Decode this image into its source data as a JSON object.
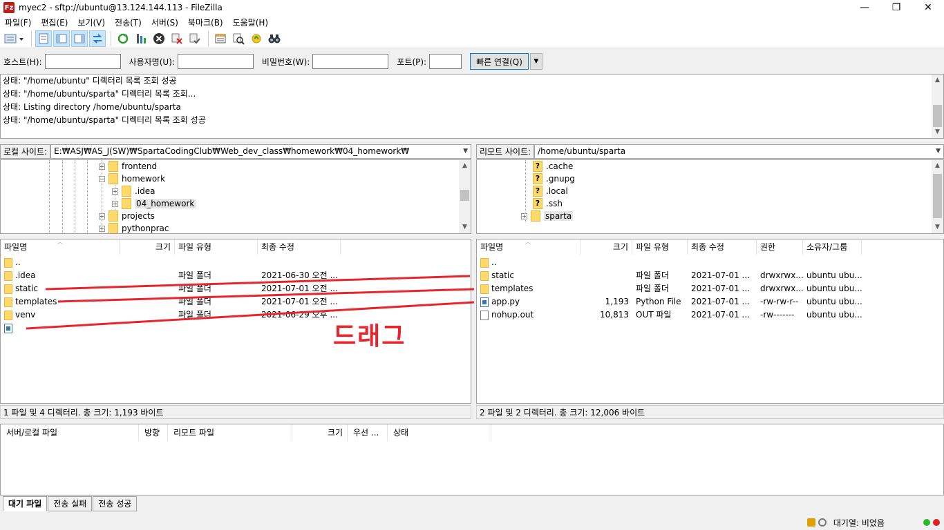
{
  "window": {
    "title": "myec2 - sftp://ubuntu@13.124.144.113 - FileZilla",
    "app_icon": "Fz",
    "minimize": "—",
    "maximize": "❐",
    "close": "✕"
  },
  "menu": [
    "파일(F)",
    "편집(E)",
    "보기(V)",
    "전송(T)",
    "서버(S)",
    "북마크(B)",
    "도움말(H)"
  ],
  "quickconnect": {
    "host_label": "호스트(H):",
    "user_label": "사용자명(U):",
    "pass_label": "비밀번호(W):",
    "port_label": "포트(P):",
    "connect_button": "빠른 연결(Q)",
    "dropdown": "▼"
  },
  "log": [
    "상태:  \"/home/ubuntu\" 디렉터리 목록 조회 성공",
    "상태:  \"/home/ubuntu/sparta\" 디렉터리 목록 조회...",
    "상태:  Listing directory /home/ubuntu/sparta",
    "상태:  \"/home/ubuntu/sparta\" 디렉터리 목록 조회 성공"
  ],
  "local": {
    "site_label": "로컬 사이트:",
    "path": "E:₩ASJ₩AS_J(SW)₩SpartaCodingClub₩Web_dev_class₩homework₩04_homework₩",
    "tree": [
      {
        "label": "frontend",
        "expander": "+"
      },
      {
        "label": "homework",
        "expander": "−"
      },
      {
        "label": ".idea",
        "expander": "+"
      },
      {
        "label": "04_homework",
        "expander": "+"
      },
      {
        "label": "projects",
        "expander": "+"
      },
      {
        "label": "pythonprac",
        "expander": "+"
      }
    ],
    "columns": {
      "name": "파일명",
      "size": "크기",
      "type": "파일 유형",
      "modified": "최종 수정"
    },
    "files": [
      {
        "name": "..",
        "size": "",
        "type": "",
        "modified": "",
        "icon": "folder"
      },
      {
        "name": ".idea",
        "size": "",
        "type": "파일 폴더",
        "modified": "2021-06-30 오전 ...",
        "icon": "folder"
      },
      {
        "name": "static",
        "size": "",
        "type": "파일 폴더",
        "modified": "2021-07-01 오전 ...",
        "icon": "folder"
      },
      {
        "name": "templates",
        "size": "",
        "type": "파일 폴더",
        "modified": "2021-07-01 오전 ...",
        "icon": "folder"
      },
      {
        "name": "venv",
        "size": "",
        "type": "파일 폴더",
        "modified": "2021-06-29 오후 ...",
        "icon": "folder"
      },
      {
        "name": "",
        "size": "",
        "type": "",
        "modified": "",
        "icon": "python-file"
      }
    ],
    "status": "1 파일 및 4 디렉터리. 총 크기: 1,193 바이트"
  },
  "remote": {
    "site_label": "리모트 사이트:",
    "path": "/home/ubuntu/sparta",
    "tree": [
      {
        "label": ".cache",
        "icon": "question-folder"
      },
      {
        "label": ".gnupg",
        "icon": "question-folder"
      },
      {
        "label": ".local",
        "icon": "question-folder"
      },
      {
        "label": ".ssh",
        "icon": "question-folder"
      },
      {
        "label": "sparta",
        "icon": "folder",
        "expander": "+"
      }
    ],
    "columns": {
      "name": "파일명",
      "size": "크기",
      "type": "파일 유형",
      "modified": "최종 수정",
      "perms": "권한",
      "owner": "소유자/그룹"
    },
    "files": [
      {
        "name": "..",
        "size": "",
        "type": "",
        "modified": "",
        "perms": "",
        "owner": "",
        "icon": "folder"
      },
      {
        "name": "static",
        "size": "",
        "type": "파일 폴더",
        "modified": "2021-07-01 ...",
        "perms": "drwxrwx...",
        "owner": "ubuntu ubu...",
        "icon": "folder"
      },
      {
        "name": "templates",
        "size": "",
        "type": "파일 폴더",
        "modified": "2021-07-01 ...",
        "perms": "drwxrwx...",
        "owner": "ubuntu ubu...",
        "icon": "folder"
      },
      {
        "name": "app.py",
        "size": "1,193",
        "type": "Python File",
        "modified": "2021-07-01 ...",
        "perms": "-rw-rw-r--",
        "owner": "ubuntu ubu...",
        "icon": "python-file"
      },
      {
        "name": "nohup.out",
        "size": "10,813",
        "type": "OUT 파일",
        "modified": "2021-07-01 ...",
        "perms": "-rw-------",
        "owner": "ubuntu ubu...",
        "icon": "file"
      }
    ],
    "status": "2 파일 및 2 디렉터리. 총 크기: 12,006 바이트"
  },
  "queue": {
    "columns": [
      "서버/로컬 파일",
      "방향",
      "리모트 파일",
      "크기",
      "우선 ...",
      "상태"
    ],
    "tabs": [
      "대기 파일",
      "전송 실패",
      "전송 성공"
    ]
  },
  "bottom": {
    "queue_status": "대기열: 비었음"
  },
  "annotation": {
    "drag_text": "드래그",
    "color": "#e8242c"
  },
  "colors": {
    "folder": "#ffd96a",
    "accent": "#0078d7",
    "led_green": "#2eb82e",
    "led_red": "#d22"
  }
}
